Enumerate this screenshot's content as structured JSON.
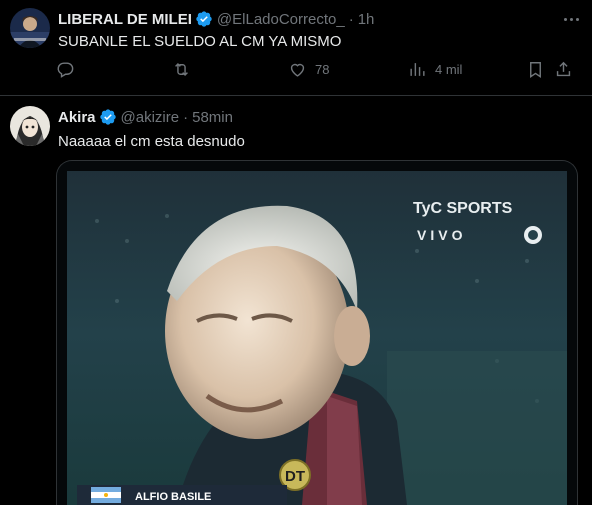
{
  "tweet1": {
    "name": "LIBERAL DE MILEI",
    "handle": "@ElLadoCorrecto_",
    "separator": "·",
    "time": "1h",
    "text": "SUBANLE EL SUELDO AL CM YA MISMO",
    "likes": "78",
    "views": "4 mil"
  },
  "tweet2": {
    "name": "Akira",
    "handle": "@akizire",
    "separator": "·",
    "time": "58min",
    "text": "Naaaaa el cm esta desnudo",
    "video": {
      "channel": "TyC SPORTS",
      "live": "VIVO",
      "badge": "DT",
      "caption": "ALFIO BASILE"
    }
  },
  "colors": {
    "background": "#000000",
    "text": "#e7e9ea",
    "muted": "#71767b",
    "verified": "#1d9bf0",
    "divider": "#2f3336"
  }
}
